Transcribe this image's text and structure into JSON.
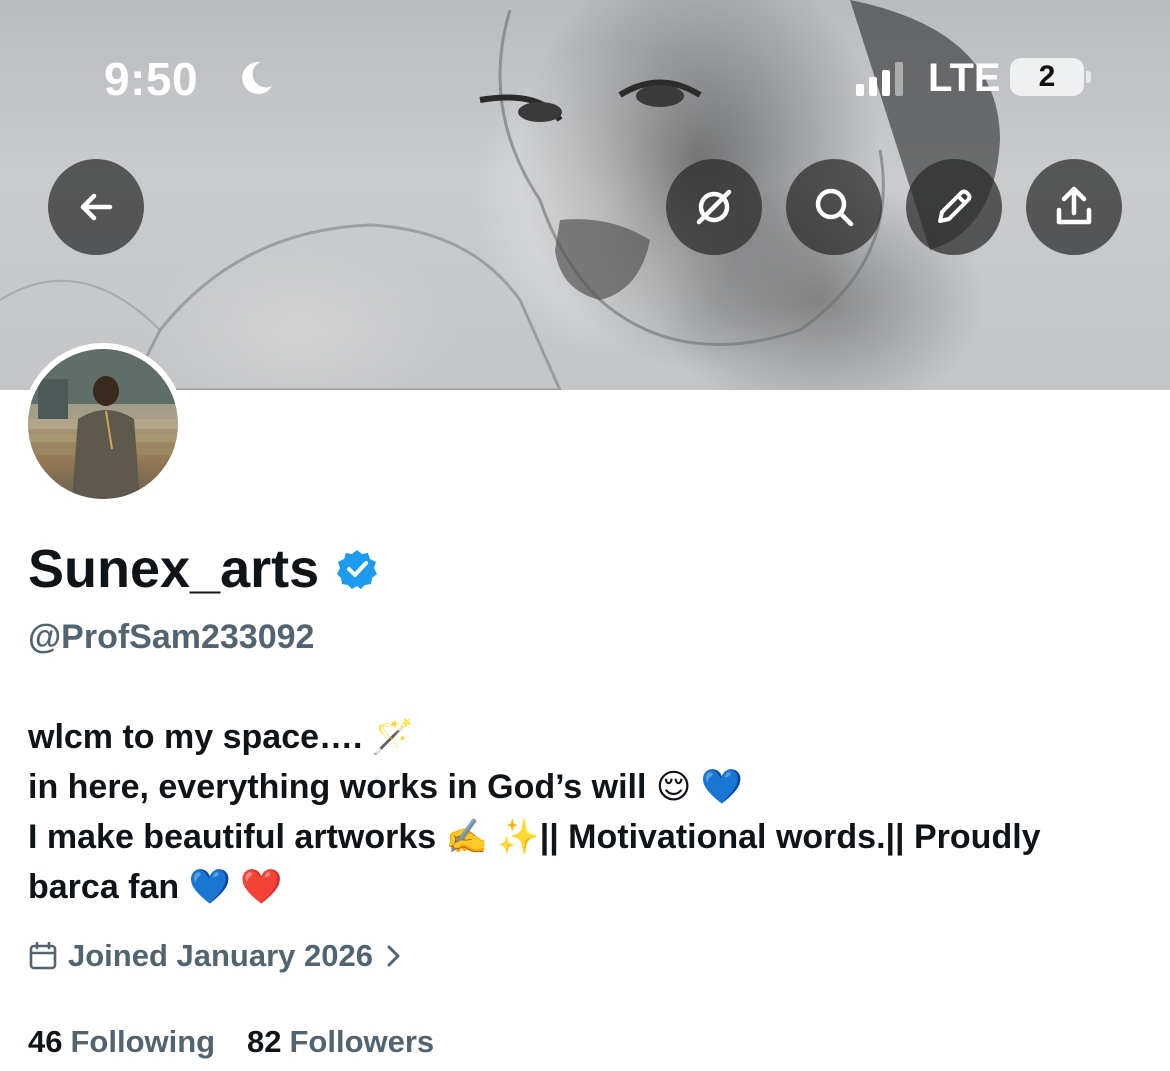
{
  "status_bar": {
    "time": "9:50",
    "network": "LTE",
    "battery": "2"
  },
  "banner": {
    "back_icon": "arrow-left-icon",
    "action_icons": [
      "no-sync-icon",
      "search-icon",
      "pencil-icon",
      "share-icon"
    ]
  },
  "profile": {
    "display_name": "Sunex_arts",
    "handle": "@ProfSam233092",
    "bio_lines": [
      "wlcm to my space…. 🪄",
      "in here, everything works in God’s will 😌 💙",
      "I make beautiful artworks ✍️ ✨|| Motivational words.|| Proudly",
      "barca fan 💙 ❤️"
    ],
    "joined": "Joined January 2026",
    "following_count": "46",
    "following_label": "Following",
    "followers_count": "82",
    "followers_label": "Followers"
  },
  "colors": {
    "text_primary": "#0f1419",
    "text_secondary": "#536471",
    "verified_blue": "#1d9bf0"
  }
}
